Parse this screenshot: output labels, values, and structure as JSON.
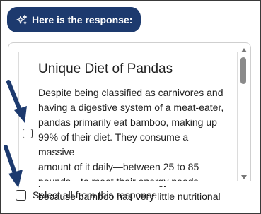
{
  "header": {
    "label": "Here is the response:",
    "icon": "sparkle-icon",
    "bg_color": "#1d3a6e"
  },
  "response": {
    "title": "Unique Diet of Pandas",
    "lines": [
      "Despite being classified as carnivores and",
      "having a digestive system of a meat-eater,",
      "pandas primarily eat bamboo, making up",
      "99% of their diet. They consume a massive",
      "amount of it daily—between 25 to 85",
      "pounds—to meet their energy needs",
      "because bamboo has very little nutritional"
    ]
  },
  "select_all": {
    "label": "Select all from this response"
  },
  "annotations": {
    "arrow_color": "#1d3a6e"
  }
}
